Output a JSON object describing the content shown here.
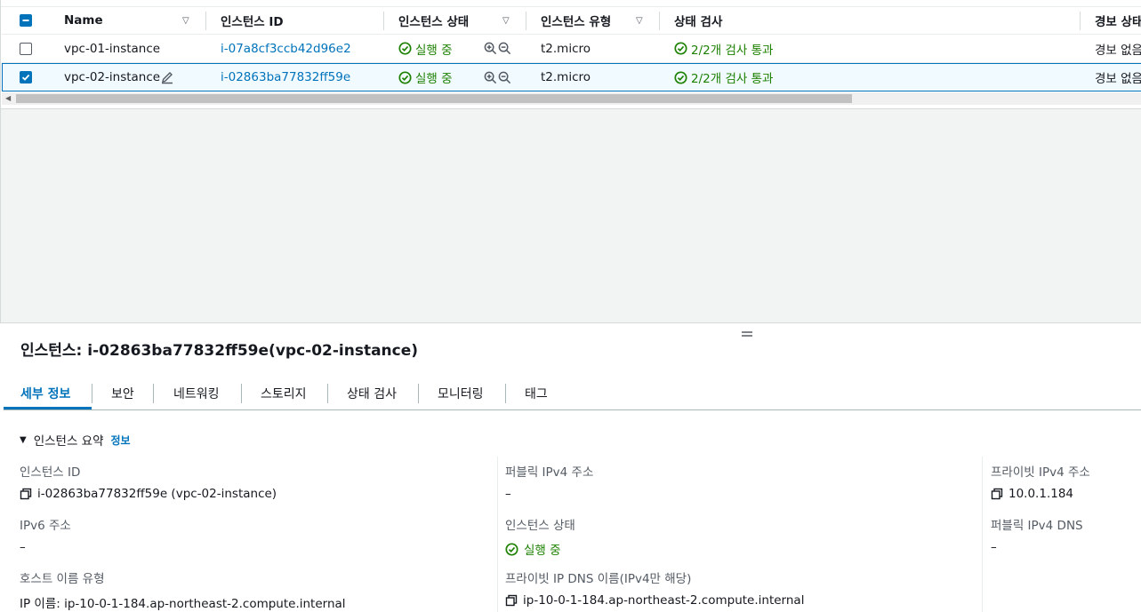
{
  "table": {
    "columns": [
      "Name",
      "인스턴스 ID",
      "인스턴스 상태",
      "인스턴스 유형",
      "상태 검사",
      "경보 상태"
    ],
    "rows": [
      {
        "selected": false,
        "name": "vpc-01-instance",
        "instance_id": "i-07a8cf3ccb42d96e2",
        "state": "실행 중",
        "type": "t2.micro",
        "check": "2/2개 검사 통과",
        "alarm": "경보 없음"
      },
      {
        "selected": true,
        "name": "vpc-02-instance",
        "instance_id": "i-02863ba77832ff59e",
        "state": "실행 중",
        "type": "t2.micro",
        "check": "2/2개 검사 통과",
        "alarm": "경보 없음"
      }
    ]
  },
  "details": {
    "title": "인스턴스: i-02863ba77832ff59e(vpc-02-instance)",
    "tabs": [
      "세부 정보",
      "보안",
      "네트워킹",
      "스토리지",
      "상태 검사",
      "모니터링",
      "태그"
    ],
    "active_tab": "세부 정보",
    "summary_label": "인스턴스 요약",
    "info_link": "정보",
    "fields": {
      "instance_id": {
        "label": "인스턴스 ID",
        "value": "i-02863ba77832ff59e (vpc-02-instance)"
      },
      "public_ipv4": {
        "label": "퍼블릭 IPv4 주소",
        "value": "–"
      },
      "private_ipv4": {
        "label": "프라이빗 IPv4 주소",
        "value": "10.0.1.184"
      },
      "ipv6": {
        "label": "IPv6 주소",
        "value": "–"
      },
      "instance_state": {
        "label": "인스턴스 상태",
        "value": "실행 중"
      },
      "public_ipv4_dns": {
        "label": "퍼블릭 IPv4 DNS",
        "value": "–"
      },
      "hostname_type": {
        "label": "호스트 이름 유형",
        "value": "IP 이름: ip-10-0-1-184.ap-northeast-2.compute.internal"
      },
      "private_ip_dns": {
        "label": "프라이빗 IP DNS 이름(IPv4만 해당)",
        "value": "ip-10-0-1-184.ap-northeast-2.compute.internal"
      }
    }
  },
  "colors": {
    "link": "#0073bb",
    "success": "#1d8102",
    "selected_row_bg": "#f1faff"
  }
}
